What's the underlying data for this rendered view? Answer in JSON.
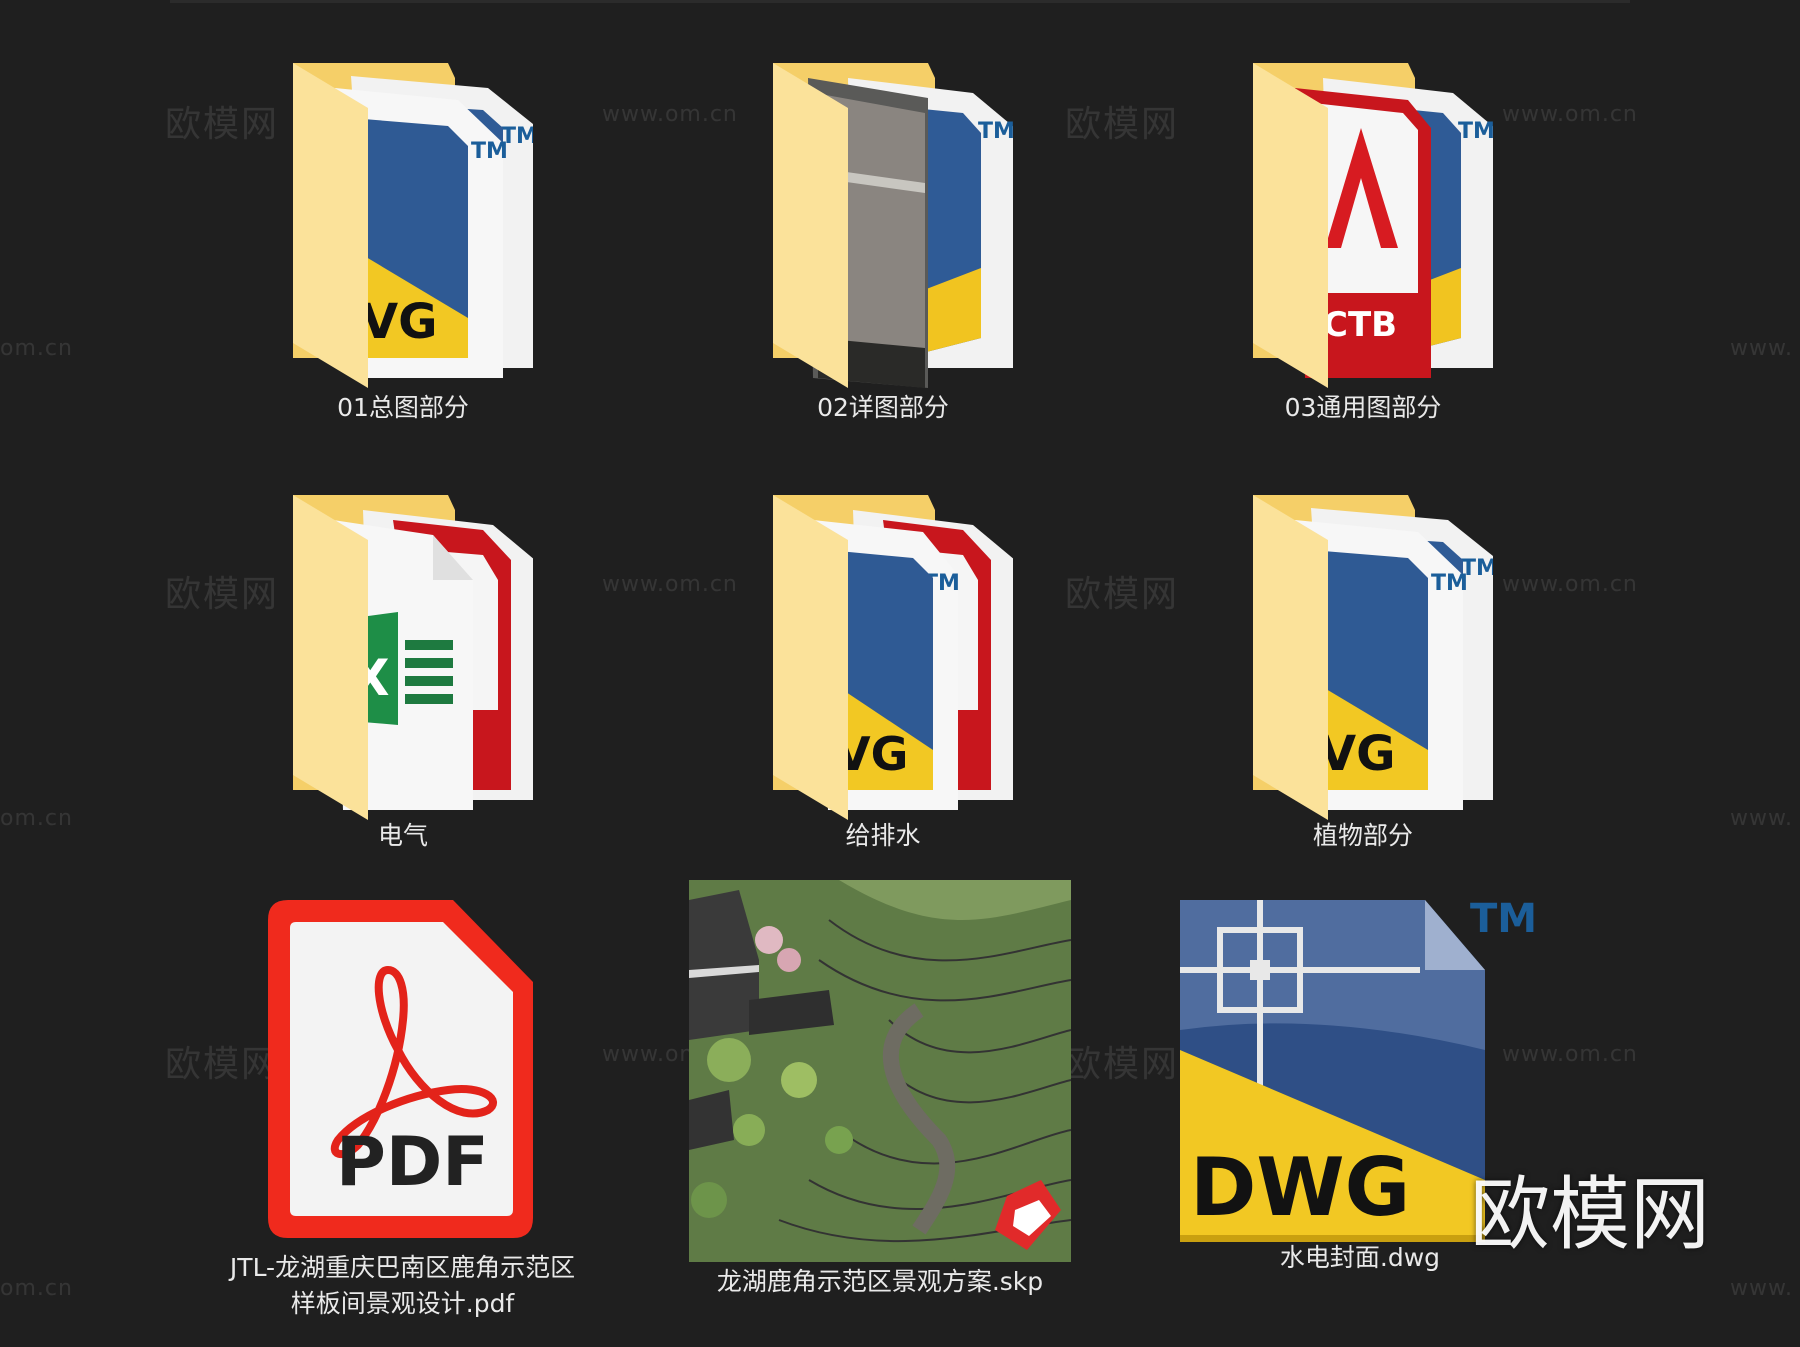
{
  "watermark": {
    "cn": "欧模网",
    "url": "www.om.cn",
    "url_partial": "om.cn",
    "url_partial_right": "www."
  },
  "folders": [
    {
      "label": "01总图部分",
      "cover": "dwg",
      "badge": "VG"
    },
    {
      "label": "02详图部分",
      "cover": "stone-photo",
      "badge": ""
    },
    {
      "label": "03通用图部分",
      "cover": "ctb",
      "badge": "CTB"
    },
    {
      "label": "电气",
      "cover": "excel-pdf",
      "badge": ""
    },
    {
      "label": "给排水",
      "cover": "dwg-pdf",
      "badge": "VG"
    },
    {
      "label": "植物部分",
      "cover": "dwg",
      "badge": "VG"
    }
  ],
  "files": [
    {
      "label_line1": "JTL-龙湖重庆巴南区鹿角示范区",
      "label_line2": "样板间景观设计.pdf",
      "icon": "pdf-icon",
      "icon_text": "PDF"
    },
    {
      "label_line1": "龙湖鹿角示范区景观方案.skp",
      "icon": "sketchup-render"
    },
    {
      "label_line1": "水电封面.dwg",
      "icon": "dwg-icon",
      "icon_text": "DWG",
      "tm": "TM"
    }
  ],
  "overlay_watermark": "欧模网",
  "colors": {
    "background": "#1f1f1f",
    "folder_yellow": "#f6d36b",
    "dwg_blue": "#2e4f86",
    "dwg_yellow": "#f3c928",
    "pdf_red": "#f0291d"
  }
}
